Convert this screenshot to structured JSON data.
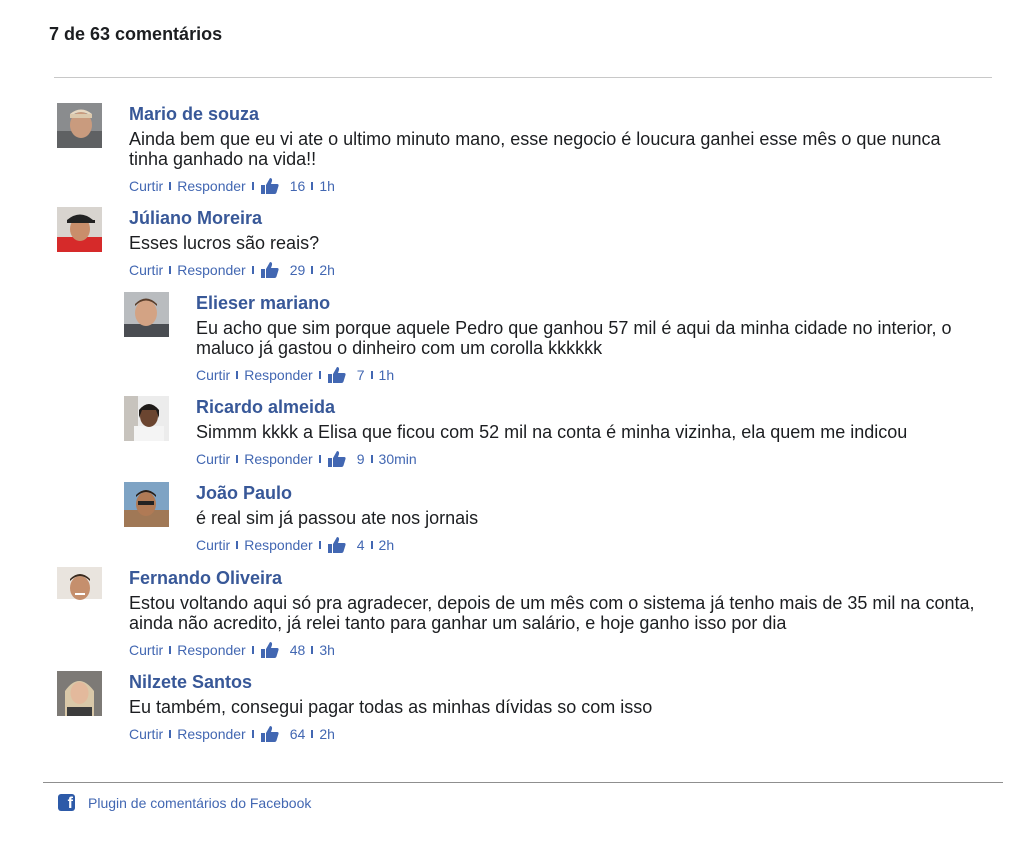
{
  "header": {
    "title": "7 de 63 comentários"
  },
  "actions": {
    "like_label": "Curtir",
    "reply_label": "Responder"
  },
  "comments": [
    {
      "author": "Mario de souza",
      "text": "Ainda bem que eu vi ate o ultimo minuto mano, esse negocio é loucura ganhei esse mês o que nunca tinha ganhado na vida!!",
      "likes": "16",
      "time": "1h"
    },
    {
      "author": "Júliano Moreira",
      "text": "Esses lucros são reais?",
      "likes": "29",
      "time": "2h"
    },
    {
      "author": "Elieser mariano",
      "text": "Eu acho que sim porque aquele Pedro que ganhou 57 mil é aqui da minha cidade no interior, o maluco já gastou o dinheiro com um corolla kkkkkk",
      "likes": "7",
      "time": "1h"
    },
    {
      "author": "Ricardo almeida",
      "text": "Simmm kkkk a Elisa que ficou com 52 mil na conta é minha vizinha, ela quem me indicou",
      "likes": "9",
      "time": "30min"
    },
    {
      "author": "João Paulo",
      "text": "é real sim já passou ate nos jornais",
      "likes": "4",
      "time": "2h"
    },
    {
      "author": "Fernando Oliveira",
      "text": "Estou voltando aqui só pra agradecer, depois de um mês com o sistema já tenho mais de 35 mil na conta, ainda não acredito, já relei tanto para ganhar um salário, e hoje ganho isso por dia",
      "likes": "48",
      "time": "3h"
    },
    {
      "author": "Nilzete Santos",
      "text": "Eu também, consegui pagar todas as minhas dívidas so com isso",
      "likes": "64",
      "time": "2h"
    }
  ],
  "footer": {
    "text": "Plugin de comentários do Facebook",
    "icon": "facebook-icon"
  },
  "colors": {
    "link": "#385898",
    "action": "#4267b2",
    "text": "#1c1e21"
  }
}
